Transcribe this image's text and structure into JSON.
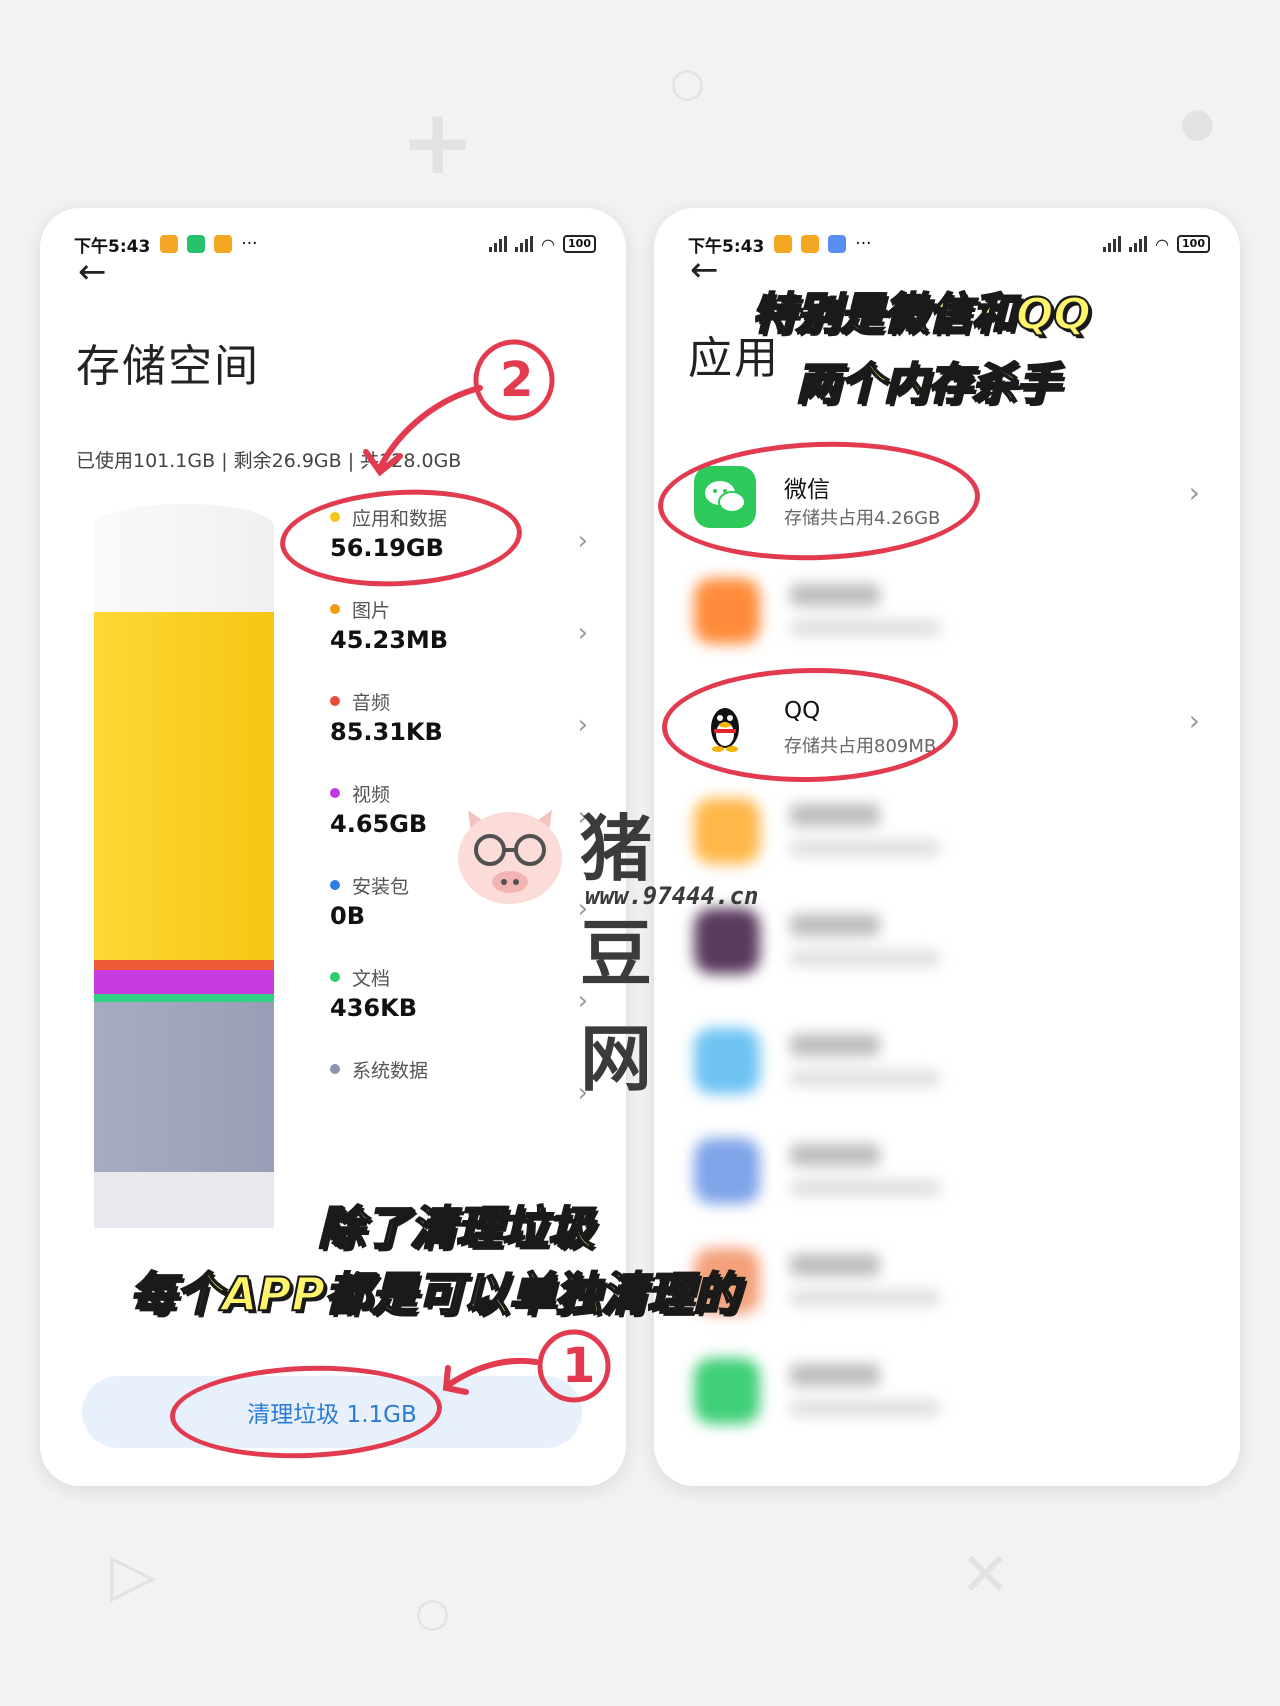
{
  "left_phone": {
    "status": {
      "time": "下午5:43",
      "battery": "100"
    },
    "title": "存储空间",
    "summary": "已使用101.1GB | 剩余26.9GB | 共128.0GB",
    "categories": [
      {
        "label": "应用和数据",
        "value": "56.19GB",
        "color": "#f5c518"
      },
      {
        "label": "图片",
        "value": "45.23MB",
        "color": "#f39c12"
      },
      {
        "label": "音频",
        "value": "85.31KB",
        "color": "#e74c3c"
      },
      {
        "label": "视频",
        "value": "4.65GB",
        "color": "#c039e0"
      },
      {
        "label": "安装包",
        "value": "0B",
        "color": "#2e7ee0"
      },
      {
        "label": "文档",
        "value": "436KB",
        "color": "#2ecc71"
      },
      {
        "label": "系统数据",
        "value": "",
        "color": "#8d93ad"
      }
    ],
    "clean_button": "清理垃圾 1.1GB",
    "annotation_1": "1",
    "annotation_2": "2"
  },
  "right_phone": {
    "status": {
      "time": "下午5:43",
      "battery": "100"
    },
    "title": "应用",
    "apps": [
      {
        "name": "微信",
        "sub": "存储共占用4.26GB"
      },
      {
        "name": "QQ",
        "sub": "存储共占用809MB"
      }
    ]
  },
  "overlays": {
    "top_line1": "特别是微信和QQ",
    "top_line2": "两个内存杀手",
    "bottom_line1": "除了清理垃圾",
    "bottom_line2": "每个APP都是可以单独清理的"
  },
  "watermark": {
    "name": "猪豆网",
    "url": "www.97444.cn"
  },
  "icons": [
    "back-arrow-icon",
    "chevron-right-icon",
    "wechat-icon",
    "qq-icon",
    "wifi-icon",
    "signal-icon",
    "battery-icon"
  ]
}
